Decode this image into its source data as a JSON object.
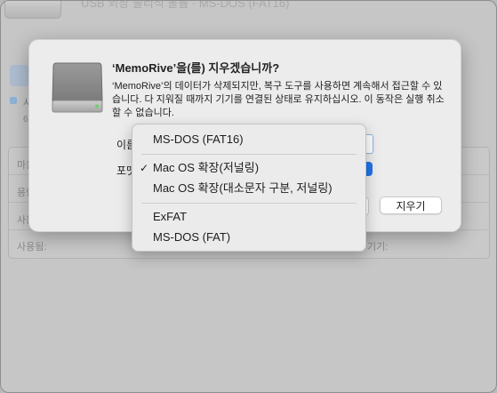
{
  "background": {
    "window_title": "USB 외장 물리적 볼륨 · MS-DOS (FAT16)",
    "sidebar_badge": "사",
    "sidebar_small": "6",
    "info_labels": [
      "마운",
      "용량",
      "사용",
      "사용됨:",
      "기기:"
    ]
  },
  "dialog": {
    "icon": "external-drive-icon",
    "title": "‘MemoRive’을(를) 지우겠습니까?",
    "message": "‘MemoRive’의 데이터가 삭제되지만, 복구 도구를 사용하면 계속해서 접근할 수 있습니다. 다 지워질 때까지 기기를 연결된 상태로 유지하십시오. 이 동작은 실행 취소할 수 없습니다.",
    "name_label": "이름",
    "format_label": "포맷",
    "erase_button": "지우기"
  },
  "format_menu": {
    "items": [
      {
        "label": "MS-DOS (FAT16)",
        "checked": false
      },
      {
        "label": "Mac OS 확장(저널링)",
        "checked": true
      },
      {
        "label": "Mac OS 확장(대소문자 구분, 저널링)",
        "checked": false
      },
      {
        "label": "ExFAT",
        "checked": false
      },
      {
        "label": "MS-DOS (FAT)",
        "checked": false
      }
    ],
    "check_glyph": "✓"
  },
  "colors": {
    "accent": "#1f74ea",
    "dialog_bg": "#ececec",
    "window_bg": "#c6c6c6"
  }
}
